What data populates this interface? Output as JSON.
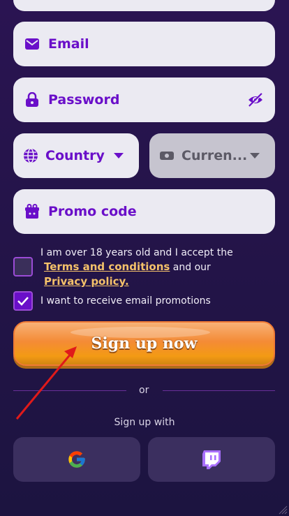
{
  "form": {
    "email_placeholder": "Email",
    "password_placeholder": "Password",
    "country_label": "Country",
    "currency_label": "Curren...",
    "promo_placeholder": "Promo code"
  },
  "consent": {
    "age_text": "I am over 18 years old and I accept the",
    "terms_link": "Terms and conditions",
    "and_our": "and our",
    "privacy_link": "Privacy policy.",
    "age_checked": false,
    "promotions_text": "I want to receive email promotions",
    "promotions_checked": true
  },
  "signup_button": "Sign up now",
  "divider_text": "or",
  "social_title": "Sign up with",
  "social": [
    {
      "name": "google",
      "icon": "google-icon"
    },
    {
      "name": "twitch",
      "icon": "twitch-icon"
    }
  ],
  "colors": {
    "accent": "#6a0fc9",
    "link": "#f4c16a",
    "button": "#f48b36",
    "annotation_arrow": "#e01a1a"
  }
}
